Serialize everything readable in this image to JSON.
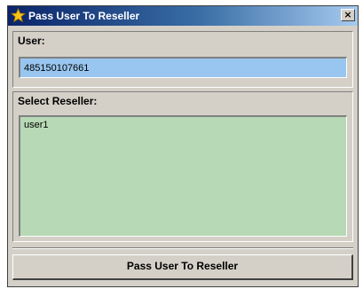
{
  "window": {
    "title": "Pass User To Reseller",
    "title_icon": "star-icon",
    "close_glyph": "×"
  },
  "user_section": {
    "label": "User:",
    "value": "485150107661"
  },
  "reseller_section": {
    "label": "Select Reseller:",
    "items": [
      "user1"
    ]
  },
  "actions": {
    "submit_label": "Pass User To Reseller"
  },
  "colors": {
    "user_field_bg": "#99c6f0",
    "reseller_list_bg": "#b7d9b5",
    "titlebar_start": "#0a246a",
    "titlebar_end": "#a6caf0"
  }
}
